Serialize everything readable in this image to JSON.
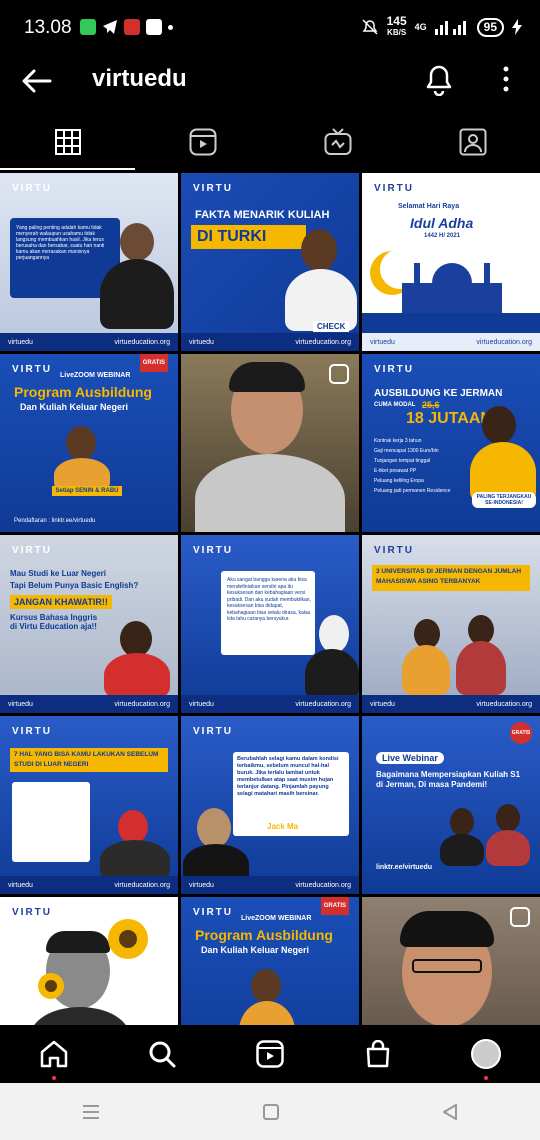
{
  "status_bar": {
    "time": "13.08",
    "speed_value": "145",
    "speed_unit": "KB/S",
    "network": "4G",
    "battery": "95"
  },
  "header": {
    "title": "virtuedu"
  },
  "tabs": [
    "grid",
    "reels",
    "igtv",
    "tagged"
  ],
  "posts": {
    "brand": "VIRTU",
    "p1": {
      "quote": "Yang paling penting adalah kamu tidak menyerah walaupun usahamu tidak langsung membuahkan hasil. Jika terus berusaha dan bersabar, suatu hari nanti kamu akan merasakan manisnya perjuangannya",
      "handle": "virtuedu",
      "site": "virtueducation.org"
    },
    "p2": {
      "headline": "FAKTA MENARIK KULIAH",
      "big": "DI TURKI",
      "cta": "CHECK",
      "handle": "virtuedu",
      "site": "virtueducation.org"
    },
    "p3": {
      "greeting": "Selamat Hari Raya",
      "title": "Idul Adha",
      "year": "1442 H/ 2021",
      "handle": "virtuedu",
      "site": "virtueducation.org"
    },
    "p4": {
      "tag": "GRATIS",
      "label": "LiveZOOM WEBINAR",
      "title": "Program Ausbildung",
      "subtitle": "Dan Kuliah Keluar Negeri",
      "schedule": "Setiap SENIN & RABU",
      "footer": "Pendaftaran : linktr.ee/virtuedu"
    },
    "p6": {
      "title": "AUSBILDUNG KE JERMAN",
      "modal": "CUMA MODAL",
      "old_price": "25,6",
      "new_price": "18 JUTAAN",
      "benefits": [
        "Kontrak kerja 3 tahun",
        "Gaji mencapai 1300 Euro/bln",
        "Tunjangan tempat tinggal",
        "E-tiket pesawat PP",
        "Peluang keliling Eropa",
        "Peluang jadi permanen Residence"
      ],
      "badge": "PALING TERJANGKAU SE-INDONESIA!"
    },
    "p7": {
      "q1": "Mau Studi ke Luar Negeri",
      "q2": "Tapi Belum Punya Basic English?",
      "warn": "JANGAN KHAWATIR!!",
      "desc": "Kursus Bahasa Inggris di Virtu Education aja!!",
      "handle": "virtuedu",
      "site": "virtueducation.org"
    },
    "p8": {
      "quote": "Aku sangat bangga karena aku bisa mendefinisikan sendiri apa itu kesuksesan dan kebahagiaan versi pribadi. Dan aku sudah membuktikan, kesuksesan bisa didapat, kebahagiaan bisa selalu dirasa, kalau kita tahu caranya bersyukur.",
      "handle": "virtuedu",
      "site": "virtueducation.org"
    },
    "p9": {
      "title": "3 UNIVERSITAS DI JERMAN DENGAN JUMLAH MAHASISWA ASING TERBANYAK",
      "handle": "virtuedu",
      "site": "virtueducation.org"
    },
    "p10": {
      "title": "7 HAL YANG BISA KAMU LAKUKAN SEBELUM STUDI DI LUAR NEGERI",
      "handle": "virtuedu",
      "site": "virtueducation.org"
    },
    "p11": {
      "quote": "Berubahlah selagi kamu dalam kondisi terbaikmu, sebelum muncul hal-hal buruk. Jika terlalu lambat untuk membetulkan atap saat musim hujan terlanjur datang. Pinjamlah payung selagi matahari masih bersinar.",
      "author": "Jack Ma",
      "handle": "virtuedu",
      "site": "virtueducation.org"
    },
    "p12": {
      "tag": "GRATIS",
      "label": "Live Webinar",
      "title": "Bagaimana Mempersiapkan Kuliah S1 di Jerman, Di masa Pandemi!",
      "register": "linktr.ee/virtuedu"
    },
    "p14": {
      "tag": "GRATIS",
      "label": "LiveZOOM WEBINAR",
      "title": "Program Ausbildung",
      "subtitle": "Dan Kuliah Keluar Negeri"
    }
  },
  "nav": [
    "home",
    "search",
    "reels",
    "shop",
    "profile"
  ],
  "colors": {
    "accent": "#0f3a96",
    "highlight": "#f5b700",
    "notif": "#ff3040"
  }
}
